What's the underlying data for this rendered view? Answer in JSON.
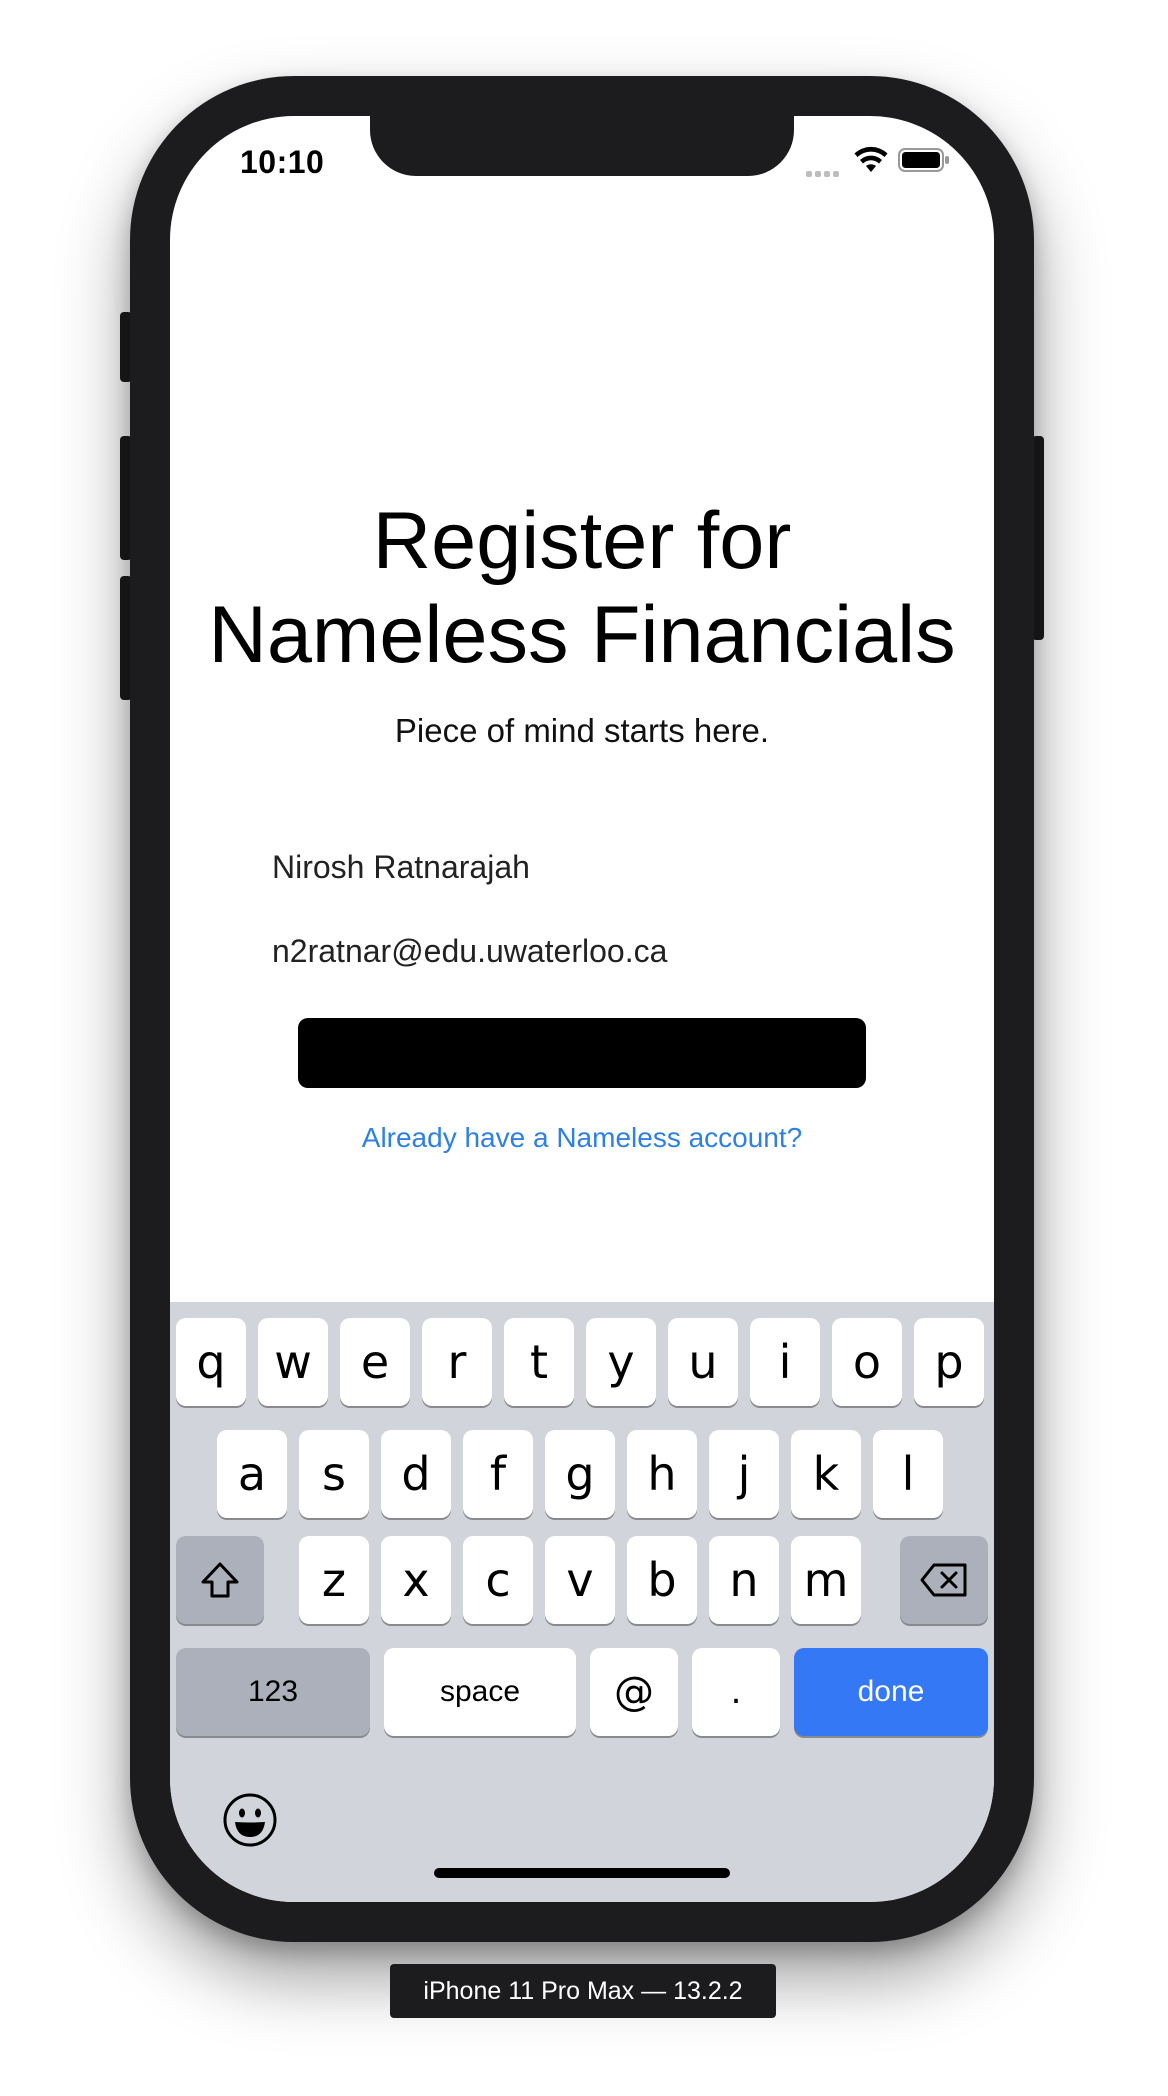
{
  "status_bar": {
    "time": "10:10",
    "icons": [
      "signal-icon",
      "wifi-icon",
      "battery-icon"
    ]
  },
  "register": {
    "title_line1": "Register for",
    "title_line2": "Nameless Financials",
    "subtitle": "Piece of mind starts here.",
    "name_value": "Nirosh Ratnarajah",
    "email_value": "n2ratnar@edu.uwaterloo.ca",
    "login_link": "Already have a Nameless account?"
  },
  "keyboard": {
    "row1": [
      "q",
      "w",
      "e",
      "r",
      "t",
      "y",
      "u",
      "i",
      "o",
      "p"
    ],
    "row2": [
      "a",
      "s",
      "d",
      "f",
      "g",
      "h",
      "j",
      "k",
      "l"
    ],
    "row3": [
      "z",
      "x",
      "c",
      "v",
      "b",
      "n",
      "m"
    ],
    "numbers_label": "123",
    "space_label": "space",
    "at_label": "@",
    "dot_label": ".",
    "done_label": "done",
    "icons": [
      "shift-icon",
      "backspace-icon",
      "emoji-icon"
    ]
  },
  "colors": {
    "link": "#2f80e5",
    "done_key": "#3478f6",
    "keyboard_bg": "#d1d4db",
    "dark_key": "#abb0ba"
  },
  "device_label": "iPhone 11 Pro Max — 13.2.2"
}
